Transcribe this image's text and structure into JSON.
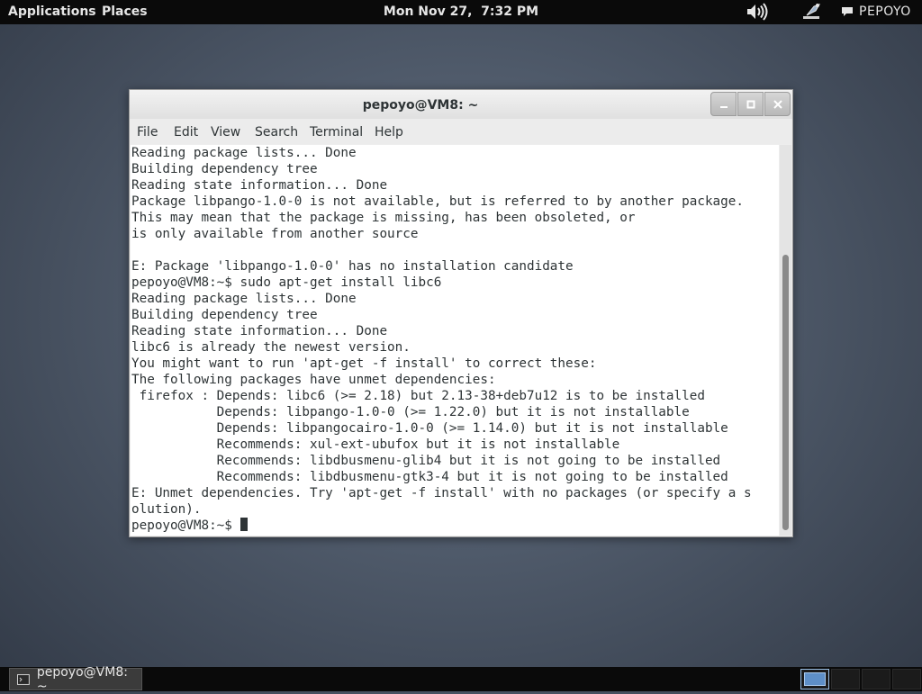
{
  "top_panel": {
    "applications_label": "Applications",
    "places_label": "Places",
    "clock": "Mon Nov 27,  7:32 PM",
    "user_label": "PEPOYO",
    "icons": [
      "volume-icon",
      "network-icon",
      "chat-icon"
    ]
  },
  "window": {
    "title": "pepoyo@VM8: ~",
    "menu": {
      "file": "File",
      "edit": "Edit",
      "view": "View",
      "search": "Search",
      "terminal": "Terminal",
      "help": "Help"
    },
    "controls": [
      "minimize",
      "maximize",
      "close"
    ]
  },
  "terminal": {
    "lines": [
      "Reading package lists... Done",
      "Building dependency tree",
      "Reading state information... Done",
      "Package libpango-1.0-0 is not available, but is referred to by another package.",
      "This may mean that the package is missing, has been obsoleted, or",
      "is only available from another source",
      "",
      "E: Package 'libpango-1.0-0' has no installation candidate",
      "pepoyo@VM8:~$ sudo apt-get install libc6",
      "Reading package lists... Done",
      "Building dependency tree",
      "Reading state information... Done",
      "libc6 is already the newest version.",
      "You might want to run 'apt-get -f install' to correct these:",
      "The following packages have unmet dependencies:",
      " firefox : Depends: libc6 (>= 2.18) but 2.13-38+deb7u12 is to be installed",
      "           Depends: libpango-1.0-0 (>= 1.22.0) but it is not installable",
      "           Depends: libpangocairo-1.0-0 (>= 1.14.0) but it is not installable",
      "           Recommends: xul-ext-ubufox but it is not installable",
      "           Recommends: libdbusmenu-glib4 but it is not going to be installed",
      "           Recommends: libdbusmenu-gtk3-4 but it is not going to be installed",
      "E: Unmet dependencies. Try 'apt-get -f install' with no packages (or specify a s",
      "olution).",
      "pepoyo@VM8:~$ "
    ]
  },
  "bottom_panel": {
    "taskbar_item": "pepoyo@VM8: ~",
    "workspaces": 4,
    "active_workspace": 1
  },
  "colors": {
    "panel": "#0a0a0a",
    "terminal_bg": "#ffffff",
    "terminal_fg": "#2e3436",
    "workspace_active": "#5e8fc7"
  }
}
